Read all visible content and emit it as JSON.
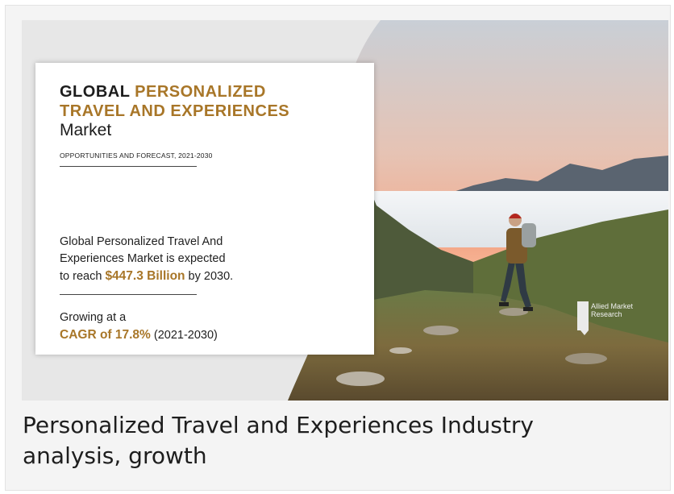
{
  "banner": {
    "title_lead": "GLOBAL",
    "title_highlight_1": "PERSONALIZED",
    "title_highlight_2": "TRAVEL AND EXPERIENCES",
    "title_tail": "Market",
    "subtitle": "OPPORTUNITIES AND FORECAST, 2021-2030",
    "stat_line_1": "Global Personalized Travel And",
    "stat_line_2": "Experiences Market is expected",
    "stat_prefix": "to reach",
    "stat_value": "$447.3 Billion",
    "stat_suffix": "by 2030.",
    "growth_line": "Growing at a",
    "growth_cagr": "CAGR of 17.8%",
    "growth_period": "(2021-2030)",
    "logo_text": "Allied Market Research",
    "colors": {
      "accent": "#a87628",
      "text": "#1c1c1c"
    }
  },
  "caption": "Personalized Travel and Experiences Industry analysis, growth"
}
